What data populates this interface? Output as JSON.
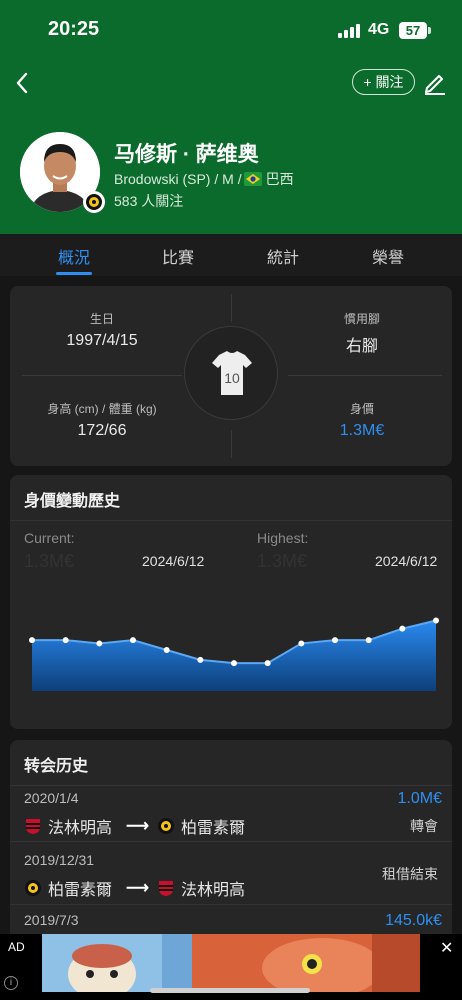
{
  "status_bar": {
    "time": "20:25",
    "network": "4G",
    "battery": "57"
  },
  "header": {
    "follow_label": "+ 關注",
    "player_name": "马修斯 · 萨维奥",
    "club_position": "Brodowski (SP) / M /",
    "nationality": "巴西",
    "followers": "583 人關注"
  },
  "tabs": [
    {
      "label": "概況",
      "active": true
    },
    {
      "label": "比賽",
      "active": false
    },
    {
      "label": "統計",
      "active": false
    },
    {
      "label": "榮譽",
      "active": false
    }
  ],
  "info": {
    "birthday_label": "生日",
    "birthday": "1997/4/15",
    "foot_label": "慣用腳",
    "foot": "右腳",
    "height_weight_label": "身高 (cm) / 體重 (kg)",
    "height_weight": "172/66",
    "value_label": "身價",
    "value": "1.3M€",
    "jersey_number": "10"
  },
  "market_value": {
    "title": "身價變動歷史",
    "current_label": "Current:",
    "current_value": "1.3M€",
    "current_date": "2024/6/12",
    "highest_label": "Highest:",
    "highest_value": "1.3M€",
    "highest_date": "2024/6/12"
  },
  "chart_data": {
    "type": "area",
    "values": [
      0.62,
      0.62,
      0.58,
      0.62,
      0.5,
      0.38,
      0.34,
      0.34,
      0.58,
      0.62,
      0.62,
      0.76,
      0.86
    ],
    "color": "#1f7fe0"
  },
  "transfers": {
    "title": "转会历史",
    "items": [
      {
        "date": "2020/1/4",
        "from": "法林明高",
        "to": "柏雷素爾",
        "fee": "1.0M€",
        "type": "轉會"
      },
      {
        "date": "2019/12/31",
        "from": "柏雷素爾",
        "to": "法林明高",
        "fee": "",
        "type": "租借結束"
      },
      {
        "date": "2019/7/3",
        "from": "",
        "to": "",
        "fee": "145.0k€",
        "type": ""
      }
    ]
  },
  "ad": {
    "label": "AD",
    "close": "✕",
    "info": "i"
  },
  "colors": {
    "header_green": "#0b6b2c",
    "accent_blue": "#2f8ff0"
  }
}
